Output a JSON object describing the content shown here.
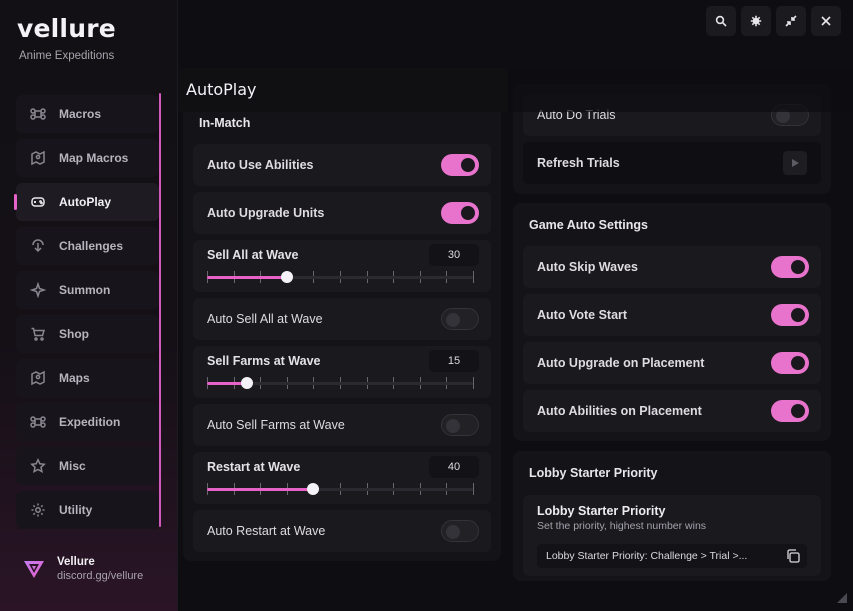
{
  "app": {
    "name": "vellure",
    "subtitle": "Anime Expeditions"
  },
  "sidebar": {
    "items": [
      {
        "label": "Macros",
        "icon": "command-icon"
      },
      {
        "label": "Map Macros",
        "icon": "map-pin-icon"
      },
      {
        "label": "AutoPlay",
        "icon": "gamepad-icon",
        "active": true
      },
      {
        "label": "Challenges",
        "icon": "challenge-icon"
      },
      {
        "label": "Summon",
        "icon": "sparkle-icon"
      },
      {
        "label": "Shop",
        "icon": "cart-icon"
      },
      {
        "label": "Maps",
        "icon": "map-icon"
      },
      {
        "label": "Expedition",
        "icon": "command-icon"
      },
      {
        "label": "Misc",
        "icon": "star-icon"
      },
      {
        "label": "Utility",
        "icon": "gear-icon"
      }
    ]
  },
  "user": {
    "name": "Vellure",
    "handle": "discord.gg/vellure"
  },
  "page": {
    "title": "AutoPlay"
  },
  "in_match": {
    "heading": "In-Match",
    "auto_use_abilities": {
      "label": "Auto Use Abilities",
      "on": true
    },
    "auto_upgrade_units": {
      "label": "Auto Upgrade Units",
      "on": true
    },
    "sell_all_at_wave": {
      "label": "Sell All at Wave",
      "value": "30",
      "fraction": 0.3
    },
    "auto_sell_all_at_wave": {
      "label": "Auto Sell All at Wave",
      "on": false
    },
    "sell_farms_at_wave": {
      "label": "Sell Farms at Wave",
      "value": "15",
      "fraction": 0.15
    },
    "auto_sell_farms_at_wave": {
      "label": "Auto Sell Farms at Wave",
      "on": false
    },
    "restart_at_wave": {
      "label": "Restart at Wave",
      "value": "40",
      "fraction": 0.4
    },
    "auto_restart_at_wave": {
      "label": "Auto Restart at Wave",
      "on": false
    }
  },
  "trials": {
    "auto_do_trials": {
      "label": "Auto Do Trials",
      "on": false
    },
    "refresh_trials": {
      "label": "Refresh Trials"
    }
  },
  "game_auto": {
    "heading": "Game Auto Settings",
    "auto_skip_waves": {
      "label": "Auto Skip Waves",
      "on": true
    },
    "auto_vote_start": {
      "label": "Auto Vote Start",
      "on": true
    },
    "auto_upgrade_on_placement": {
      "label": "Auto Upgrade on Placement",
      "on": true
    },
    "auto_abilities_on_placement": {
      "label": "Auto Abilities on Placement",
      "on": true
    }
  },
  "lobby": {
    "heading": "Lobby Starter Priority",
    "card_title": "Lobby Starter Priority",
    "card_subtitle": "Set the priority, highest number wins",
    "field_value": "Lobby Starter Priority: Challenge > Trial >..."
  },
  "colors": {
    "accent": "#e873cc",
    "bg": "#0e0d11",
    "panel": "#141318"
  }
}
